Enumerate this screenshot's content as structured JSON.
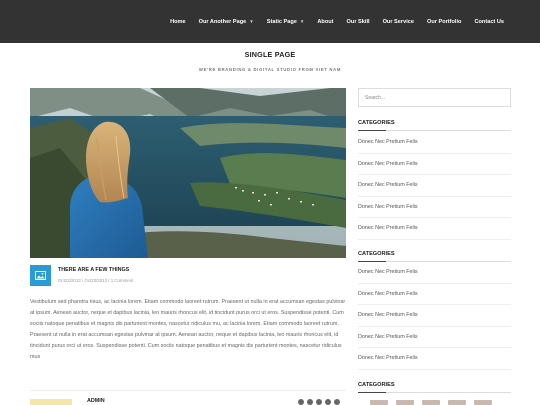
{
  "nav": {
    "items": [
      {
        "label": "Home",
        "dropdown": false
      },
      {
        "label": "Our Another Page",
        "dropdown": true
      },
      {
        "label": "Static Page",
        "dropdown": true
      },
      {
        "label": "About",
        "dropdown": false
      },
      {
        "label": "Our Skill",
        "dropdown": false
      },
      {
        "label": "Our Service",
        "dropdown": false
      },
      {
        "label": "Our Portfolio",
        "dropdown": false
      },
      {
        "label": "Contact Us",
        "dropdown": false
      }
    ]
  },
  "page": {
    "title": "SINGLE PAGE",
    "tagline": "WE'RE BRANDING & DIGITAL STUDIO FROM VIET NAM"
  },
  "post": {
    "title": "THERE ARE A FEW THINGS",
    "meta": "Oct23/2013 / Oct23/2013 / 1 Comment",
    "format_icon": "image-icon",
    "body": "Vestibulum sed pharetra risus, ac lacinia lorem. Etiam commodo laoreet rutrum. Praesent ut nulla in erat accumsan egestas pulvinar at ipsum. Aenean auctor, neque et dapibus lacinia, leo mauris rhoncus elit, id tincidunt purus orci ut eros. Suspendisse potenti. Cum sociis natoque penatibus et magnis dis parturient montes, nascetur ridiculus mu, ac lacinia lorem. Etiam commodo laoreet rutrum. Praesent ut nulla in erat accumsan egestas pulvinar at ipsum. Aenean auctor, neque et dapibus lacinia, leo mauris rhoncus elit, id tincidunt purus orci ut eros. Suspendisse potenti. Cum sociis natoque penatibus et magnis dis parturient montes, nascetur ridiculus mus",
    "author": "ADMIN"
  },
  "sidebar": {
    "search_placeholder": "Search...",
    "widget1": {
      "title": "CATEGORIES",
      "items": [
        "Donec Nec Pretium Felis",
        "Donec Nec Pretium Felis",
        "Donec Nec Pretium Felis",
        "Donec Nec Pretium Felis",
        "Donec Nec Pretium Felis"
      ]
    },
    "widget2": {
      "title": "CATEGORIES",
      "items": [
        "Donec Nec Pretium Felis",
        "Donec Nec Pretium Felis",
        "Donec Nec Pretium Felis",
        "Donec Nec Pretium Felis",
        "Donec Nec Pretium Felis"
      ]
    },
    "widget3": {
      "title": "CATEGORIES"
    }
  },
  "colors": {
    "topbar": "#333333",
    "accent": "#2b9bd6"
  }
}
